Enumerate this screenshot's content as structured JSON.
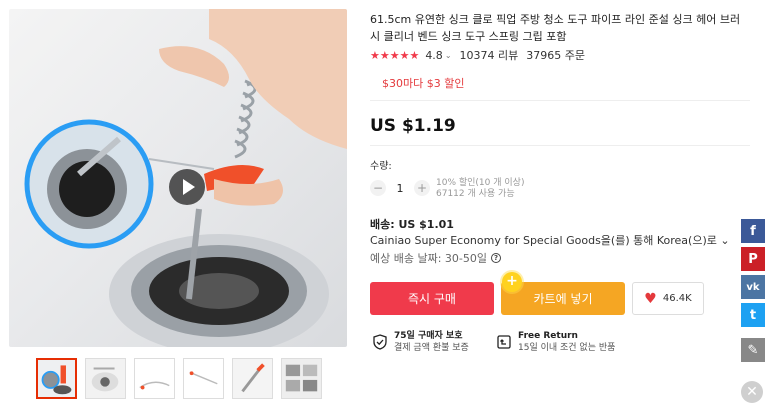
{
  "product": {
    "title": "61.5cm 유연한 싱크 클로 픽업 주방 청소 도구 파이프 라인 준설 싱크 헤어 브러시 클리너 벤드 싱크 도구 스프링 그립 포함",
    "rating": {
      "stars": "★★★★★",
      "score": "4.8",
      "reviews": "10374 리뷰",
      "orders": "37965 주문"
    },
    "promo": "$30마다 $3 할인",
    "price": "US $1.19"
  },
  "quantity": {
    "label": "수량:",
    "value": "1",
    "minus": "−",
    "plus": "+",
    "note_line1": "10% 할인(10 개 이상)",
    "note_line2": "67112 개 사용 가능"
  },
  "shipping": {
    "title": "배송: US $1.01",
    "method": "Cainiao Super Economy for Special Goods을(를) 통해 Korea(으)로 ⌄",
    "eta": "예상 배송 날짜: 30-50일"
  },
  "actions": {
    "buy_now": "즉시 구매",
    "add_to_cart": "카트에 넣기",
    "wishlist_count": "46.4K"
  },
  "guarantees": [
    {
      "title": "75일 구매자 보호",
      "sub": "결제 금액 환불 보증"
    },
    {
      "title": "Free Return",
      "sub": "15일 이내 조건 없는 반품"
    }
  ],
  "social": {
    "facebook": "f",
    "pinterest": "P",
    "vk": "vk",
    "twitter": "t"
  },
  "colors": {
    "accent_red": "#f03a4b",
    "cart_orange": "#f5a623",
    "promo_red": "#e4393c"
  },
  "icons": [
    "play-icon",
    "chevron-down-icon",
    "question-icon",
    "heart-icon",
    "shield-check-icon",
    "return-arrow-icon",
    "facebook-icon",
    "pinterest-icon",
    "vk-icon",
    "twitter-icon",
    "pencil-icon",
    "close-icon"
  ]
}
